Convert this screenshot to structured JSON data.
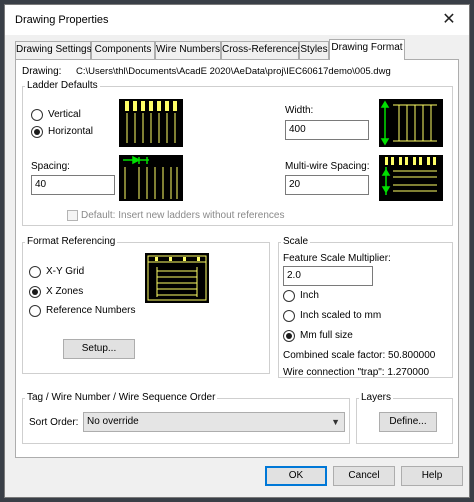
{
  "window": {
    "title": "Drawing Properties",
    "close_glyph": "✕"
  },
  "tabs": [
    {
      "label": "Drawing Settings",
      "active": false
    },
    {
      "label": "Components",
      "active": false
    },
    {
      "label": "Wire Numbers",
      "active": false
    },
    {
      "label": "Cross-References",
      "active": false
    },
    {
      "label": "Styles",
      "active": false
    },
    {
      "label": "Drawing Format",
      "active": true
    }
  ],
  "drawing": {
    "label": "Drawing:",
    "path": "C:\\Users\\thl\\Documents\\AcadE 2020\\AeData\\proj\\IEC60617demo\\005.dwg"
  },
  "ladder": {
    "group_label": "Ladder Defaults",
    "vertical_label": "Vertical",
    "horizontal_label": "Horizontal",
    "orientation_selected": "Horizontal",
    "width_label": "Width:",
    "width_value": "400",
    "spacing_label": "Spacing:",
    "spacing_value": "40",
    "multiwire_label": "Multi-wire Spacing:",
    "multiwire_value": "20",
    "default_label": "Default: Insert new ladders without references",
    "default_checked": false
  },
  "format_ref": {
    "group_label": "Format Referencing",
    "options": [
      "X-Y Grid",
      "X Zones",
      "Reference Numbers"
    ],
    "selected": "X Zones",
    "setup_label": "Setup..."
  },
  "scale": {
    "group_label": "Scale",
    "multiplier_label": "Feature Scale Multiplier:",
    "multiplier_value": "2.0",
    "options": [
      "Inch",
      "Inch scaled to mm",
      "Mm full size"
    ],
    "selected": "Mm full size",
    "combined_label": "Combined scale factor: 50.800000",
    "trap_label": "Wire connection \"trap\": 1.270000"
  },
  "tag": {
    "group_label": "Tag / Wire Number / Wire Sequence Order",
    "sort_label": "Sort Order:",
    "sort_value": "No override"
  },
  "layers": {
    "group_label": "Layers",
    "define_label": "Define..."
  },
  "footer": {
    "ok": "OK",
    "cancel": "Cancel",
    "help": "Help"
  },
  "colors": {
    "preview_bg": "#000000",
    "preview_lines": "#ffff66",
    "preview_arrow": "#00e000",
    "accent": "#0078d7"
  }
}
